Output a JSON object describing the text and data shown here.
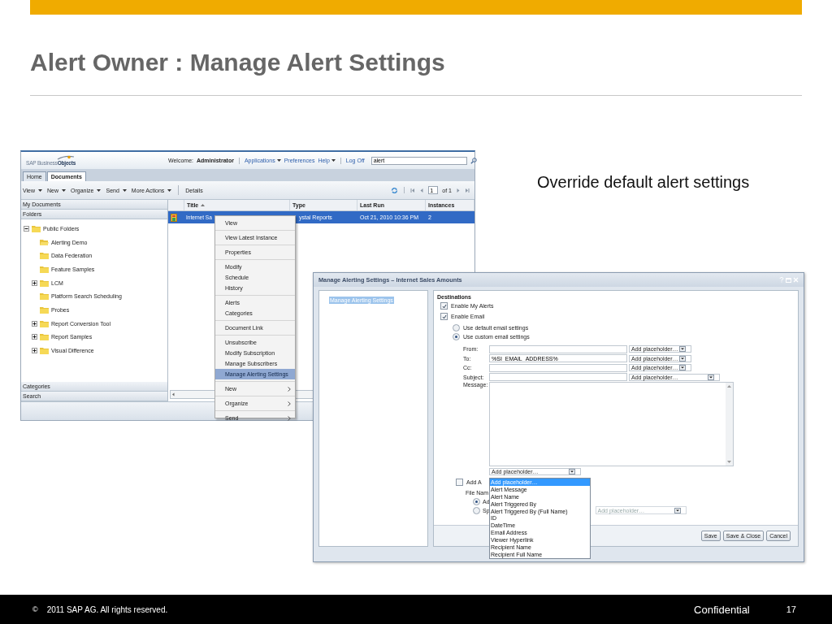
{
  "title": "Alert Owner : Manage Alert Settings",
  "caption": "Override default alert settings",
  "portal": {
    "logo": "SAP Business**Objects**",
    "welcome_label": "Welcome:",
    "user": "Administrator",
    "links": [
      {
        "label": "Applications",
        "menu": true
      },
      {
        "label": "Preferences",
        "menu": false
      },
      {
        "label": "Help",
        "menu": true
      },
      {
        "label": "Log Off",
        "menu": false
      }
    ],
    "search": {
      "value": "alert"
    },
    "tabs": [
      {
        "label": "Home",
        "selected": false
      },
      {
        "label": "Documents",
        "selected": true
      }
    ],
    "toolbar": [
      {
        "label": "View",
        "menu": true
      },
      {
        "label": "New",
        "menu": true
      },
      {
        "label": "Organize",
        "menu": true
      },
      {
        "label": "Send",
        "menu": true
      },
      {
        "label": "More Actions",
        "menu": true
      },
      {
        "label": "Details",
        "menu": false
      }
    ],
    "pager": {
      "page": "1",
      "of": "of 1"
    },
    "panels": {
      "my_documents": "My Documents",
      "folders": "Folders",
      "categories": "Categories",
      "search": "Search"
    },
    "tree": [
      {
        "label": "Public Folders",
        "expandable": true,
        "expanded": true,
        "open": false,
        "children": [
          {
            "label": "Alerting Demo",
            "expandable": false,
            "open": true
          },
          {
            "label": "Data Federation",
            "expandable": false,
            "open": false
          },
          {
            "label": "Feature Samples",
            "expandable": false,
            "open": false
          },
          {
            "label": "LCM",
            "expandable": true,
            "expanded": false,
            "open": false
          },
          {
            "label": "Platform Search Scheduling",
            "expandable": false,
            "open": false
          },
          {
            "label": "Probes",
            "expandable": false,
            "open": false
          },
          {
            "label": "Report Conversion Tool",
            "expandable": true,
            "expanded": false,
            "open": false
          },
          {
            "label": "Report Samples",
            "expandable": true,
            "expanded": false,
            "open": false
          },
          {
            "label": "Visual Difference",
            "expandable": true,
            "expanded": false,
            "open": false
          }
        ]
      }
    ],
    "table": {
      "columns": [
        {
          "label": "Title",
          "sorted": true
        },
        {
          "label": "Type",
          "sorted": false
        },
        {
          "label": "Last Run",
          "sorted": false
        },
        {
          "label": "Instances",
          "sorted": false
        }
      ],
      "rows": [
        {
          "title": "Internet Sa",
          "type": "ystal Reports",
          "last_run": "Oct 21, 2010 10:36 PM",
          "instances": "2",
          "selected": true
        }
      ]
    }
  },
  "context_menu": {
    "groups": [
      [
        {
          "label": "View",
          "submenu": false,
          "selected": false
        }
      ],
      [
        {
          "label": "View Latest Instance",
          "submenu": false,
          "selected": false
        }
      ],
      [
        {
          "label": "Properties",
          "submenu": false,
          "selected": false
        }
      ],
      [
        {
          "label": "Modify",
          "submenu": false,
          "selected": false
        },
        {
          "label": "Schedule",
          "submenu": false,
          "selected": false
        },
        {
          "label": "History",
          "submenu": false,
          "selected": false
        }
      ],
      [
        {
          "label": "Alerts",
          "submenu": false,
          "selected": false
        },
        {
          "label": "Categories",
          "submenu": false,
          "selected": false
        }
      ],
      [
        {
          "label": "Document Link",
          "submenu": false,
          "selected": false
        }
      ],
      [
        {
          "label": "Unsubscribe",
          "submenu": false,
          "selected": false
        },
        {
          "label": "Modify Subscription",
          "submenu": false,
          "selected": false
        },
        {
          "label": "Manage Subscribers",
          "submenu": false,
          "selected": false
        },
        {
          "label": "Manage Alerting Settings",
          "submenu": false,
          "selected": true
        }
      ],
      [
        {
          "label": "New",
          "submenu": true,
          "selected": false
        }
      ],
      [
        {
          "label": "Organize",
          "submenu": true,
          "selected": false
        }
      ],
      [
        {
          "label": "Send",
          "submenu": true,
          "selected": false
        }
      ]
    ]
  },
  "dialog": {
    "title": "Manage Alerting Settings – Internet Sales Amounts",
    "nav": [
      {
        "label": "Manage Alerting Settings",
        "selected": true
      }
    ],
    "section": "Destinations",
    "checks": [
      {
        "label": "Enable My Alerts",
        "checked": true
      },
      {
        "label": "Enable Email",
        "checked": true
      }
    ],
    "email_options": [
      {
        "label": "Use default email settings",
        "selected": false
      },
      {
        "label": "Use custom email settings",
        "selected": true
      }
    ],
    "fields": [
      {
        "label": "From:",
        "combo": "Add placeholder…",
        "kind": "short"
      },
      {
        "label": "To:",
        "value": "%SI_EMAIL_ADDRESS%",
        "combo": "Add placeholder…",
        "kind": "short"
      },
      {
        "label": "Cc:",
        "combo": "Add placeholder…",
        "kind": "short"
      },
      {
        "label": "Subject:",
        "combo": "Add placeholder…",
        "kind": "wide"
      }
    ],
    "message_label": "Message:",
    "message_combo": "Add placeholder…",
    "placeholder_options": [
      {
        "label": "Add placeholder…",
        "selected": true
      },
      {
        "label": "Alert Message",
        "selected": false
      },
      {
        "label": "Alert Name",
        "selected": false
      },
      {
        "label": "Alert Triggered By",
        "selected": false
      },
      {
        "label": "Alert Triggered By (Full Name)",
        "selected": false
      },
      {
        "label": "ID",
        "selected": false
      },
      {
        "label": "DateTime",
        "selected": false
      },
      {
        "label": "Email Address",
        "selected": false
      },
      {
        "label": "Viewer Hyperlink",
        "selected": false
      },
      {
        "label": "Recipient Name",
        "selected": false
      },
      {
        "label": "Recipient Full Name",
        "selected": false
      }
    ],
    "attachment": {
      "label": "Add A",
      "checked": false
    },
    "file_name_label": "File Nam",
    "file_name_options": [
      {
        "label": "Ad",
        "selected": true
      },
      {
        "label": "Sp",
        "selected": false
      }
    ],
    "file_name_combo": {
      "value": "Add placeholder…",
      "disabled": true
    },
    "buttons": [
      "Save",
      "Save & Close",
      "Cancel"
    ]
  },
  "footer": {
    "symbol": "©",
    "copyright": "2011 SAP AG. All rights reserved.",
    "confidential": "Confidential",
    "page": "17"
  }
}
